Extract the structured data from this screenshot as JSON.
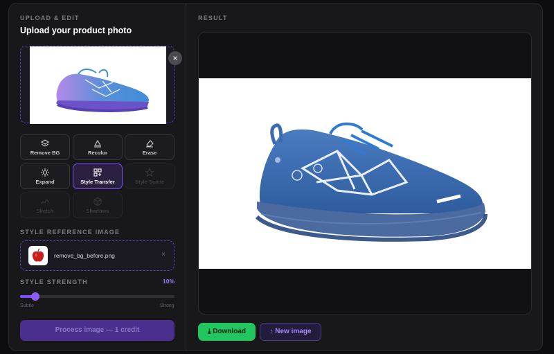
{
  "left_panel": {
    "section_label": "UPLOAD & EDIT",
    "title": "Upload your product photo",
    "upload": {
      "close_glyph": "×"
    },
    "tools": [
      {
        "label": "Remove BG",
        "icon": "layers-icon",
        "state": "normal"
      },
      {
        "label": "Recolor",
        "icon": "palette-icon",
        "state": "normal"
      },
      {
        "label": "Erase",
        "icon": "eraser-icon",
        "state": "normal"
      },
      {
        "label": "Expand",
        "icon": "expand-icon",
        "state": "normal"
      },
      {
        "label": "Style Transfer",
        "icon": "style-transfer-icon",
        "state": "active"
      },
      {
        "label": "Style Scene",
        "icon": "star-icon",
        "state": "disabled"
      },
      {
        "label": "Sketch",
        "icon": "sketch-icon",
        "state": "disabled"
      },
      {
        "label": "Shadows",
        "icon": "cube-icon",
        "state": "disabled"
      }
    ],
    "style_reference": {
      "label": "STYLE REFERENCE IMAGE",
      "filename": "remove_bg_before.png",
      "remove_glyph": "×"
    },
    "style_strength": {
      "label": "STYLE STRENGTH",
      "value_text": "10%",
      "value": 0.1,
      "min_label": "Subtle",
      "max_label": "Strong"
    },
    "process_button": "Process image — 1 credit"
  },
  "right_panel": {
    "section_label": "RESULT",
    "download_label": "Download",
    "new_image_label": "New image"
  },
  "colors": {
    "accent": "#7c4dff",
    "success": "#22c55e",
    "background": "#18181b"
  }
}
